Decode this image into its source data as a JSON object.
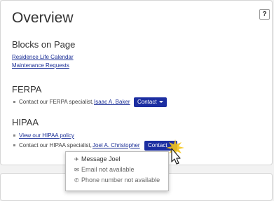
{
  "title": "Overview",
  "help_label": "?",
  "blocks": {
    "heading": "Blocks on Page",
    "links": [
      "Residence Life Calendar",
      "Maintenance Requests"
    ]
  },
  "ferpa": {
    "heading": "FERPA",
    "text": "Contact our FERPA specialist,",
    "person": "Isaac A. Baker",
    "button": "Contact"
  },
  "hipaa": {
    "heading": "HIPAA",
    "policy_link": "View our HIPAA policy",
    "text": "Contact our HIPAA specialist,",
    "person": "Joel A. Christopher",
    "button": "Contact"
  },
  "menu": {
    "items": [
      {
        "label": "Message Joel",
        "icon": "send-icon",
        "enabled": true
      },
      {
        "label": "Email not available",
        "icon": "mail-icon",
        "enabled": false
      },
      {
        "label": "Phone number not available",
        "icon": "phone-icon",
        "enabled": false
      }
    ]
  },
  "colors": {
    "link": "#1a2e96",
    "button": "#1c2ea1",
    "highlight": "#f5c518"
  }
}
